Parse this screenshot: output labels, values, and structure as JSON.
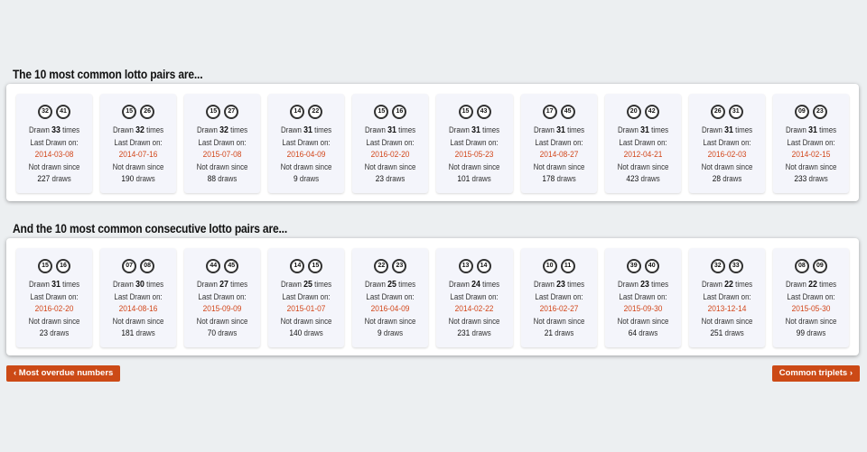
{
  "sections": [
    {
      "title": "The 10 most common lotto pairs are...",
      "cards": [
        {
          "balls": [
            "32",
            "41"
          ],
          "drawn": "33",
          "last": "2014-03-08",
          "since": "227"
        },
        {
          "balls": [
            "15",
            "26"
          ],
          "drawn": "32",
          "last": "2014-07-16",
          "since": "190"
        },
        {
          "balls": [
            "15",
            "27"
          ],
          "drawn": "32",
          "last": "2015-07-08",
          "since": "88"
        },
        {
          "balls": [
            "14",
            "22"
          ],
          "drawn": "31",
          "last": "2016-04-09",
          "since": "9"
        },
        {
          "balls": [
            "15",
            "16"
          ],
          "drawn": "31",
          "last": "2016-02-20",
          "since": "23"
        },
        {
          "balls": [
            "15",
            "43"
          ],
          "drawn": "31",
          "last": "2015-05-23",
          "since": "101"
        },
        {
          "balls": [
            "17",
            "45"
          ],
          "drawn": "31",
          "last": "2014-08-27",
          "since": "178"
        },
        {
          "balls": [
            "20",
            "42"
          ],
          "drawn": "31",
          "last": "2012-04-21",
          "since": "423"
        },
        {
          "balls": [
            "26",
            "31"
          ],
          "drawn": "31",
          "last": "2016-02-03",
          "since": "28"
        },
        {
          "balls": [
            "09",
            "23"
          ],
          "drawn": "31",
          "last": "2014-02-15",
          "since": "233"
        }
      ]
    },
    {
      "title": "And the 10 most common consecutive lotto pairs are...",
      "cards": [
        {
          "balls": [
            "15",
            "16"
          ],
          "drawn": "31",
          "last": "2016-02-20",
          "since": "23"
        },
        {
          "balls": [
            "07",
            "08"
          ],
          "drawn": "30",
          "last": "2014-08-16",
          "since": "181"
        },
        {
          "balls": [
            "44",
            "45"
          ],
          "drawn": "27",
          "last": "2015-09-09",
          "since": "70"
        },
        {
          "balls": [
            "14",
            "15"
          ],
          "drawn": "25",
          "last": "2015-01-07",
          "since": "140"
        },
        {
          "balls": [
            "22",
            "23"
          ],
          "drawn": "25",
          "last": "2016-04-09",
          "since": "9"
        },
        {
          "balls": [
            "13",
            "14"
          ],
          "drawn": "24",
          "last": "2014-02-22",
          "since": "231"
        },
        {
          "balls": [
            "10",
            "11"
          ],
          "drawn": "23",
          "last": "2016-02-27",
          "since": "21"
        },
        {
          "balls": [
            "39",
            "40"
          ],
          "drawn": "23",
          "last": "2015-09-30",
          "since": "64"
        },
        {
          "balls": [
            "32",
            "33"
          ],
          "drawn": "22",
          "last": "2013-12-14",
          "since": "251"
        },
        {
          "balls": [
            "08",
            "09"
          ],
          "drawn": "22",
          "last": "2015-05-30",
          "since": "99"
        }
      ]
    }
  ],
  "labels": {
    "drawn_prefix": "Drawn",
    "drawn_suffix": "times",
    "last_drawn": "Last Drawn on:",
    "not_drawn": "Not drawn since",
    "draws": "draws"
  },
  "nav": {
    "prev_label": "‹ Most overdue numbers",
    "next_label": "Common triplets ›"
  },
  "colors": {
    "accent": "#cc4a16",
    "date": "#d2461a",
    "background": "#eceff1"
  }
}
